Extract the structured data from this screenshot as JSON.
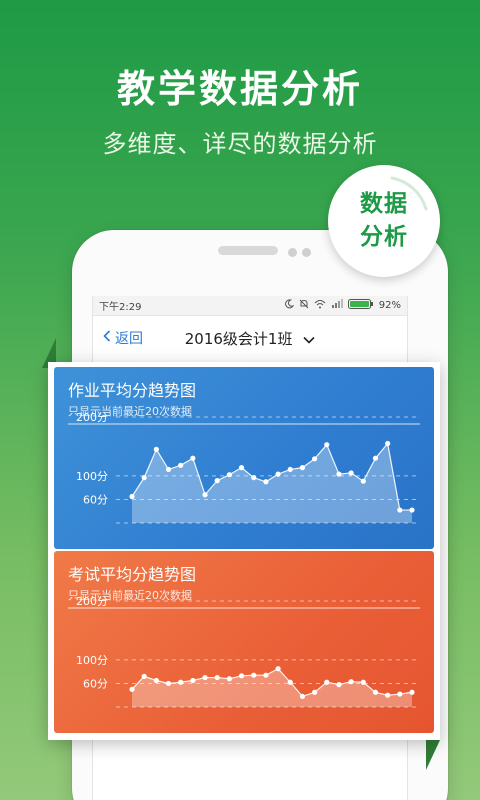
{
  "promo": {
    "headline": "教学数据分析",
    "subline": "多维度、详尽的数据分析",
    "badge_line1": "数据",
    "badge_line2": "分析"
  },
  "statusbar": {
    "time": "下午2:29",
    "battery": "92%",
    "icons": [
      "moon-icon",
      "mute-icon",
      "wifi-icon",
      "signal-icon",
      "battery-icon"
    ]
  },
  "navbar": {
    "back_label": "返回",
    "title": "2016级会计1班",
    "back_icon": "chevron-left-icon",
    "title_icon": "chevron-down-icon"
  },
  "colors": {
    "green": "#1d9a45",
    "blue_card": "#2f7dd1",
    "orange_card": "#ea5f37",
    "link": "#2f7bd6"
  },
  "chart_data": [
    {
      "type": "area",
      "title": "作业平均分趋势图",
      "subtitle": "只显示当前最近20次数据",
      "y_ticks": [
        "200分",
        "100分",
        "60分"
      ],
      "y_tick_values": [
        200,
        100,
        60
      ],
      "ylim": [
        20,
        200
      ],
      "grid": true,
      "x": [
        1,
        2,
        3,
        4,
        5,
        6,
        7,
        8,
        9,
        10,
        11,
        12,
        13,
        14,
        15,
        16,
        17,
        18,
        19,
        20,
        21,
        22,
        23,
        24
      ],
      "values": [
        65,
        97,
        145,
        111,
        118,
        130,
        68,
        92,
        102,
        114,
        97,
        90,
        103,
        111,
        114,
        129,
        153,
        103,
        105,
        91,
        130,
        155,
        42,
        42
      ]
    },
    {
      "type": "area",
      "title": "考试平均分趋势图",
      "subtitle": "只显示当前最近20次数据",
      "y_ticks": [
        "200分",
        "100分",
        "60分"
      ],
      "y_tick_values": [
        200,
        100,
        60
      ],
      "ylim": [
        20,
        200
      ],
      "grid": true,
      "x": [
        1,
        2,
        3,
        4,
        5,
        6,
        7,
        8,
        9,
        10,
        11,
        12,
        13,
        14,
        15,
        16,
        17,
        18,
        19,
        20,
        21,
        22,
        23,
        24
      ],
      "values": [
        50,
        72,
        65,
        60,
        62,
        65,
        70,
        70,
        68,
        73,
        74,
        74,
        85,
        62,
        38,
        45,
        62,
        58,
        63,
        62,
        45,
        40,
        42,
        45
      ]
    }
  ]
}
